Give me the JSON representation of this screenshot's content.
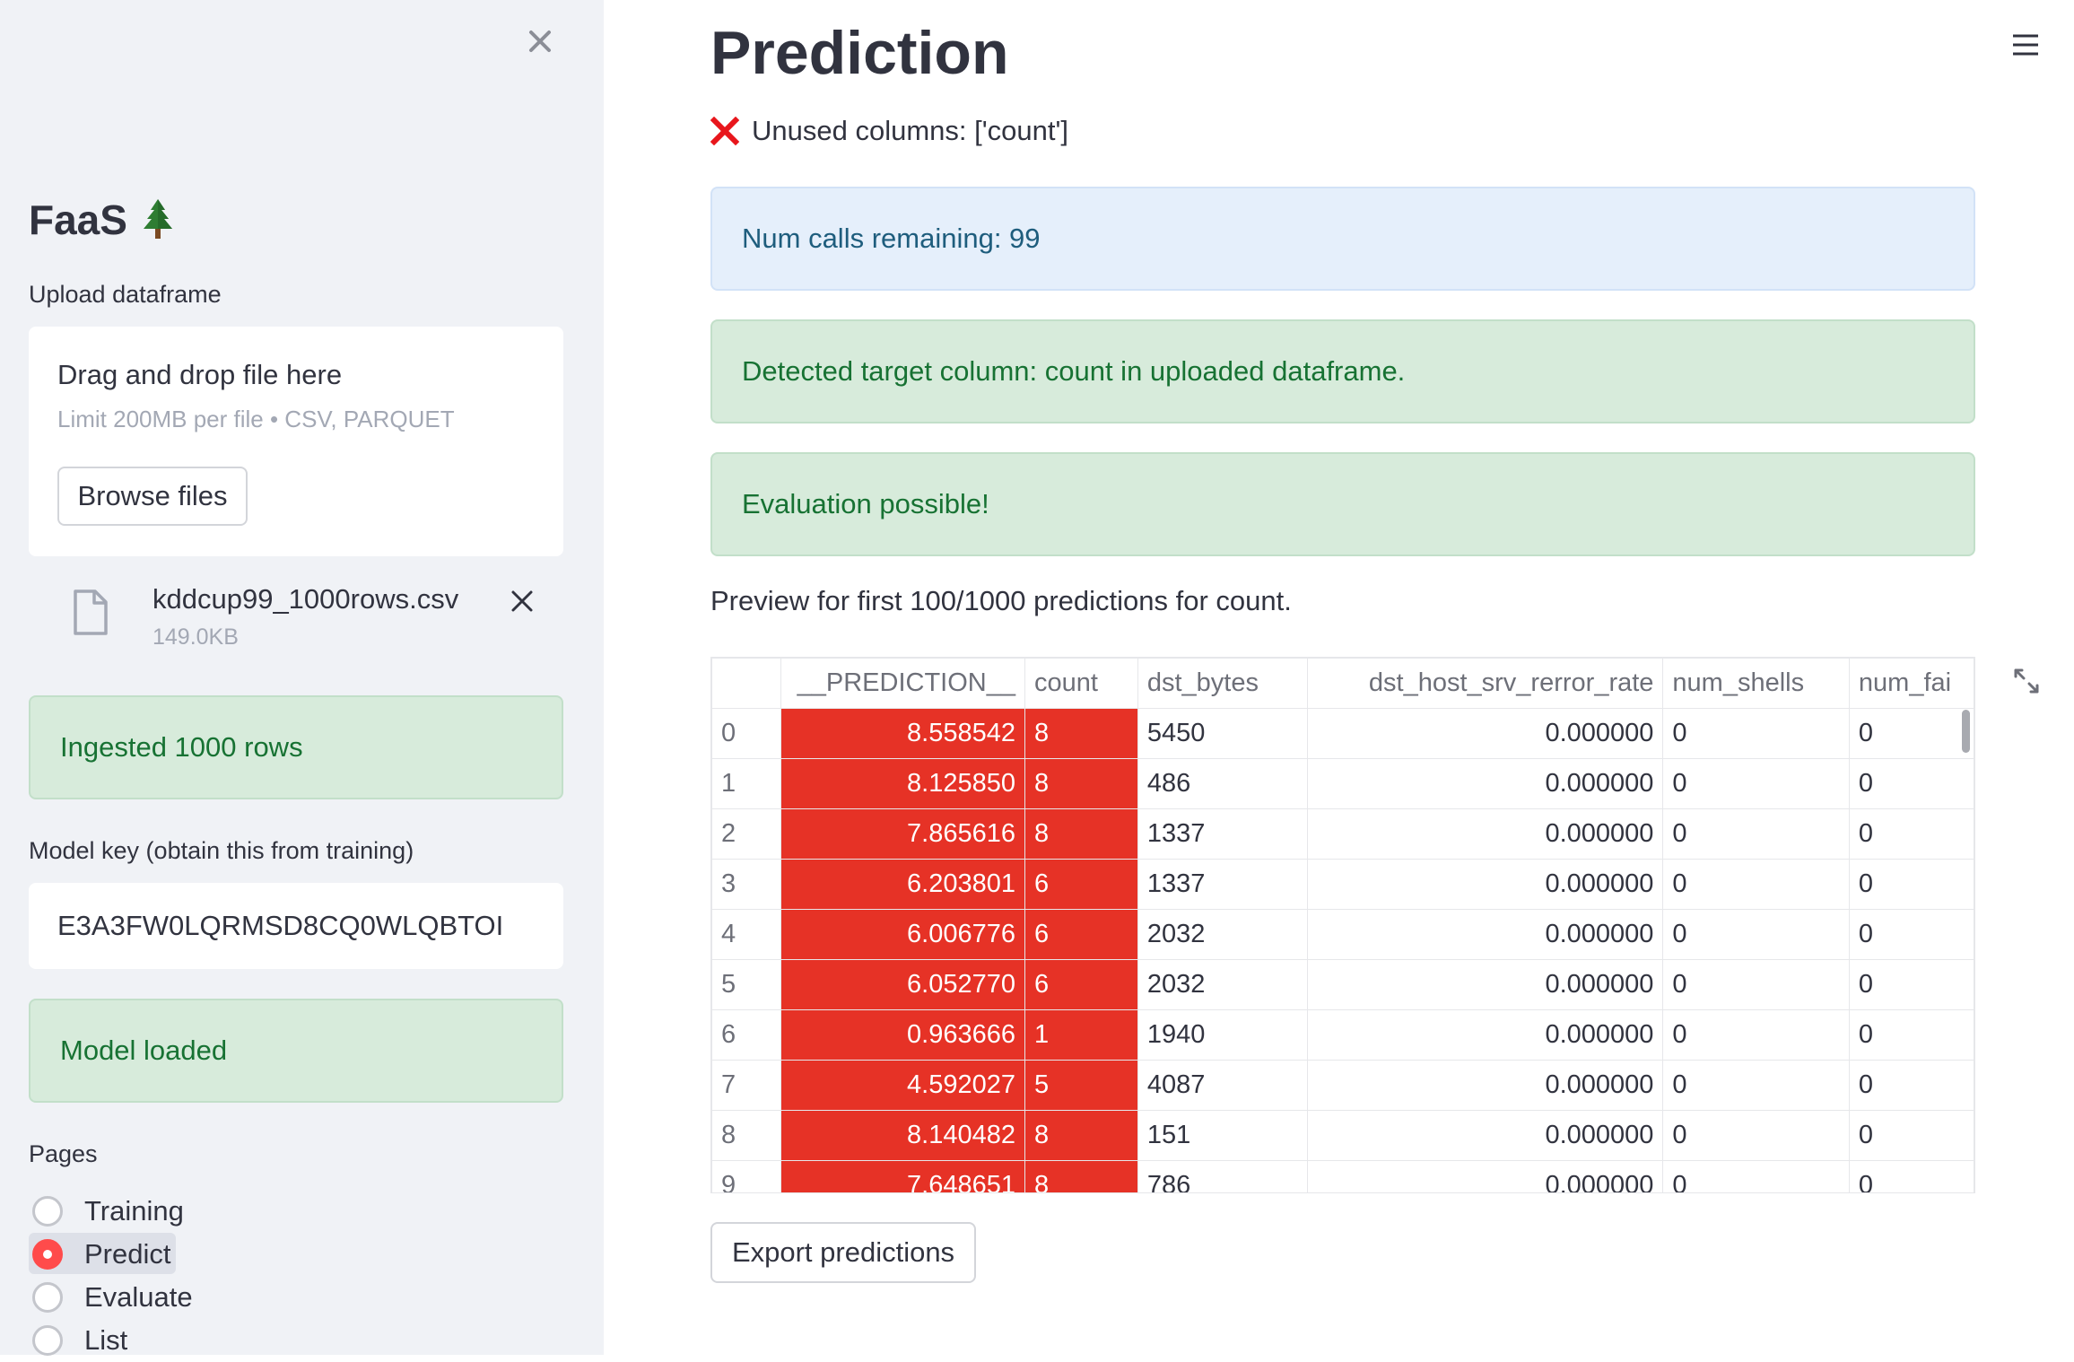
{
  "sidebar": {
    "app_title": "FaaS",
    "upload_label": "Upload dataframe",
    "uploader": {
      "drag_drop": "Drag and drop file here",
      "limit": "Limit 200MB per file • CSV, PARQUET",
      "browse_label": "Browse files"
    },
    "file": {
      "name": "kddcup99_1000rows.csv",
      "size": "149.0KB"
    },
    "ingested_alert": "Ingested 1000 rows",
    "model_key_label": "Model key (obtain this from training)",
    "model_key_value": "E3A3FW0LQRMSD8CQ0WLQBTOI",
    "model_loaded_alert": "Model loaded",
    "pages_label": "Pages",
    "pages": [
      {
        "label": "Training",
        "selected": false
      },
      {
        "label": "Predict",
        "selected": true
      },
      {
        "label": "Evaluate",
        "selected": false
      },
      {
        "label": "List",
        "selected": false
      }
    ]
  },
  "main": {
    "title": "Prediction",
    "unused_columns": "Unused columns: ['count']",
    "alerts": {
      "calls_remaining": "Num calls remaining: 99",
      "target_column": "Detected target column: count in uploaded dataframe.",
      "evaluation": "Evaluation possible!"
    },
    "preview_caption": "Preview for first 100/1000 predictions for count.",
    "table": {
      "columns": [
        "",
        "__PREDICTION__",
        "count",
        "dst_bytes",
        "dst_host_srv_rerror_rate",
        "num_shells",
        "num_fai"
      ],
      "rows": [
        [
          "0",
          "8.558542",
          "8",
          "5450",
          "0.000000",
          "0",
          "0"
        ],
        [
          "1",
          "8.125850",
          "8",
          "486",
          "0.000000",
          "0",
          "0"
        ],
        [
          "2",
          "7.865616",
          "8",
          "1337",
          "0.000000",
          "0",
          "0"
        ],
        [
          "3",
          "6.203801",
          "6",
          "1337",
          "0.000000",
          "0",
          "0"
        ],
        [
          "4",
          "6.006776",
          "6",
          "2032",
          "0.000000",
          "0",
          "0"
        ],
        [
          "5",
          "6.052770",
          "6",
          "2032",
          "0.000000",
          "0",
          "0"
        ],
        [
          "6",
          "0.963666",
          "1",
          "1940",
          "0.000000",
          "0",
          "0"
        ],
        [
          "7",
          "4.592027",
          "5",
          "4087",
          "0.000000",
          "0",
          "0"
        ],
        [
          "8",
          "8.140482",
          "8",
          "151",
          "0.000000",
          "0",
          "0"
        ],
        [
          "9",
          "7.648651",
          "8",
          "786",
          "0.000000",
          "0",
          "0"
        ]
      ]
    },
    "export_label": "Export predictions"
  },
  "colors": {
    "accent": "#ff4b4b",
    "highlight_cell": "#e63226",
    "success_bg": "#d7ebdb",
    "success_text": "#177233",
    "info_bg": "#e5effb",
    "info_text": "#1e5d7d",
    "error_icon": "#e8161c"
  },
  "icons": [
    "close-icon",
    "tree-icon",
    "file-icon",
    "remove-file-icon",
    "hamburger-menu-icon",
    "error-x-icon",
    "expand-icon"
  ]
}
